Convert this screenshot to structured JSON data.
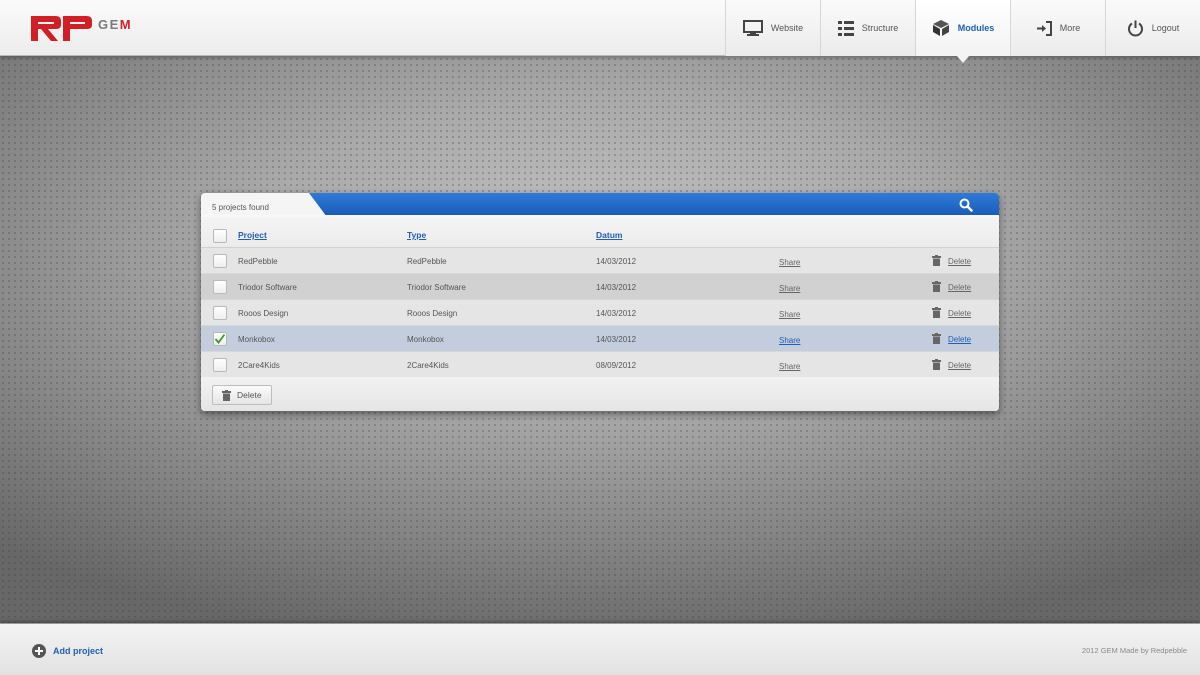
{
  "app": {
    "logo_text_ge": "GE",
    "logo_text_m": "M"
  },
  "nav": {
    "items": [
      {
        "label": "Website",
        "icon": "monitor-icon"
      },
      {
        "label": "Structure",
        "icon": "list-icon"
      },
      {
        "label": "Modules",
        "icon": "cube-icon",
        "active": true
      },
      {
        "label": "More",
        "icon": "enter-icon"
      },
      {
        "label": "Logout",
        "icon": "power-icon"
      }
    ]
  },
  "panel": {
    "count_text": "5 projects found",
    "columns": {
      "project": "Project",
      "type": "Type",
      "datum": "Datum"
    },
    "rows": [
      {
        "project": "RedPebble",
        "type": "RedPebble",
        "date": "14/03/2012",
        "share": "Share",
        "delete": "Delete",
        "checked": false
      },
      {
        "project": "Triodor Software",
        "type": "Triodor Software",
        "date": "14/03/2012",
        "share": "Share",
        "delete": "Delete",
        "checked": false
      },
      {
        "project": "Rooos Design",
        "type": "Rooos Design",
        "date": "14/03/2012",
        "share": "Share",
        "delete": "Delete",
        "checked": false
      },
      {
        "project": "Monkobox",
        "type": "Monkobox",
        "date": "14/03/2012",
        "share": "Share",
        "delete": "Delete",
        "checked": true
      },
      {
        "project": "2Care4Kids",
        "type": "2Care4Kids",
        "date": "08/09/2012",
        "share": "Share",
        "delete": "Delete",
        "checked": false
      }
    ],
    "delete_button": "Delete"
  },
  "footer": {
    "add_project": "Add project",
    "copyright": "2012 GEM Made by Redpebble"
  },
  "colors": {
    "accent": "#1f5fb4",
    "brand": "#d21f26",
    "selected_row": "#c3cddd",
    "panel_header": "#1a5cb8"
  }
}
